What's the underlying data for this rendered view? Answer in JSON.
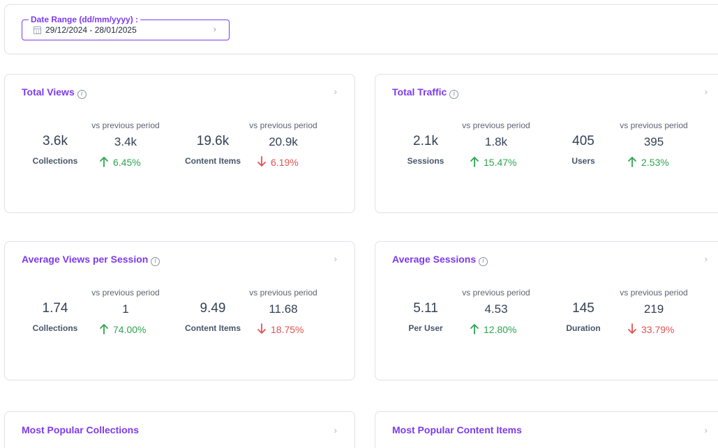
{
  "date_range": {
    "label": "Date Range (dd/mm/yyyy) :",
    "value": "29/12/2024 - 28/01/2025",
    "chevron": "›"
  },
  "icons": {
    "info": "i",
    "chevron": "›",
    "calendar": "calendar-icon"
  },
  "colors": {
    "accent": "#7c3aed",
    "up": "#2ea44f",
    "down": "#e05252"
  },
  "cards": {
    "total_views": {
      "title": "Total Views",
      "metrics": [
        {
          "value": "3.6k",
          "label": "Collections",
          "vs_label": "vs previous period",
          "previous": "3.4k",
          "change": "6.45%",
          "direction": "up"
        },
        {
          "value": "19.6k",
          "label": "Content Items",
          "vs_label": "vs previous period",
          "previous": "20.9k",
          "change": "6.19%",
          "direction": "down"
        }
      ]
    },
    "total_traffic": {
      "title": "Total Traffic",
      "metrics": [
        {
          "value": "2.1k",
          "label": "Sessions",
          "vs_label": "vs previous period",
          "previous": "1.8k",
          "change": "15.47%",
          "direction": "up"
        },
        {
          "value": "405",
          "label": "Users",
          "vs_label": "vs previous period",
          "previous": "395",
          "change": "2.53%",
          "direction": "up"
        }
      ]
    },
    "avg_views_per_session": {
      "title": "Average Views per Session",
      "metrics": [
        {
          "value": "1.74",
          "label": "Collections",
          "vs_label": "vs previous period",
          "previous": "1",
          "change": "74.00%",
          "direction": "up"
        },
        {
          "value": "9.49",
          "label": "Content Items",
          "vs_label": "vs previous period",
          "previous": "11.68",
          "change": "18.75%",
          "direction": "down"
        }
      ]
    },
    "avg_sessions": {
      "title": "Average Sessions",
      "metrics": [
        {
          "value": "5.11",
          "label": "Per User",
          "vs_label": "vs previous period",
          "previous": "4.53",
          "change": "12.80%",
          "direction": "up"
        },
        {
          "value": "145",
          "label": "Duration",
          "vs_label": "vs previous period",
          "previous": "219",
          "change": "33.79%",
          "direction": "down"
        }
      ]
    },
    "popular_collections": {
      "title": "Most Popular Collections"
    },
    "popular_content": {
      "title": "Most Popular Content Items"
    }
  }
}
